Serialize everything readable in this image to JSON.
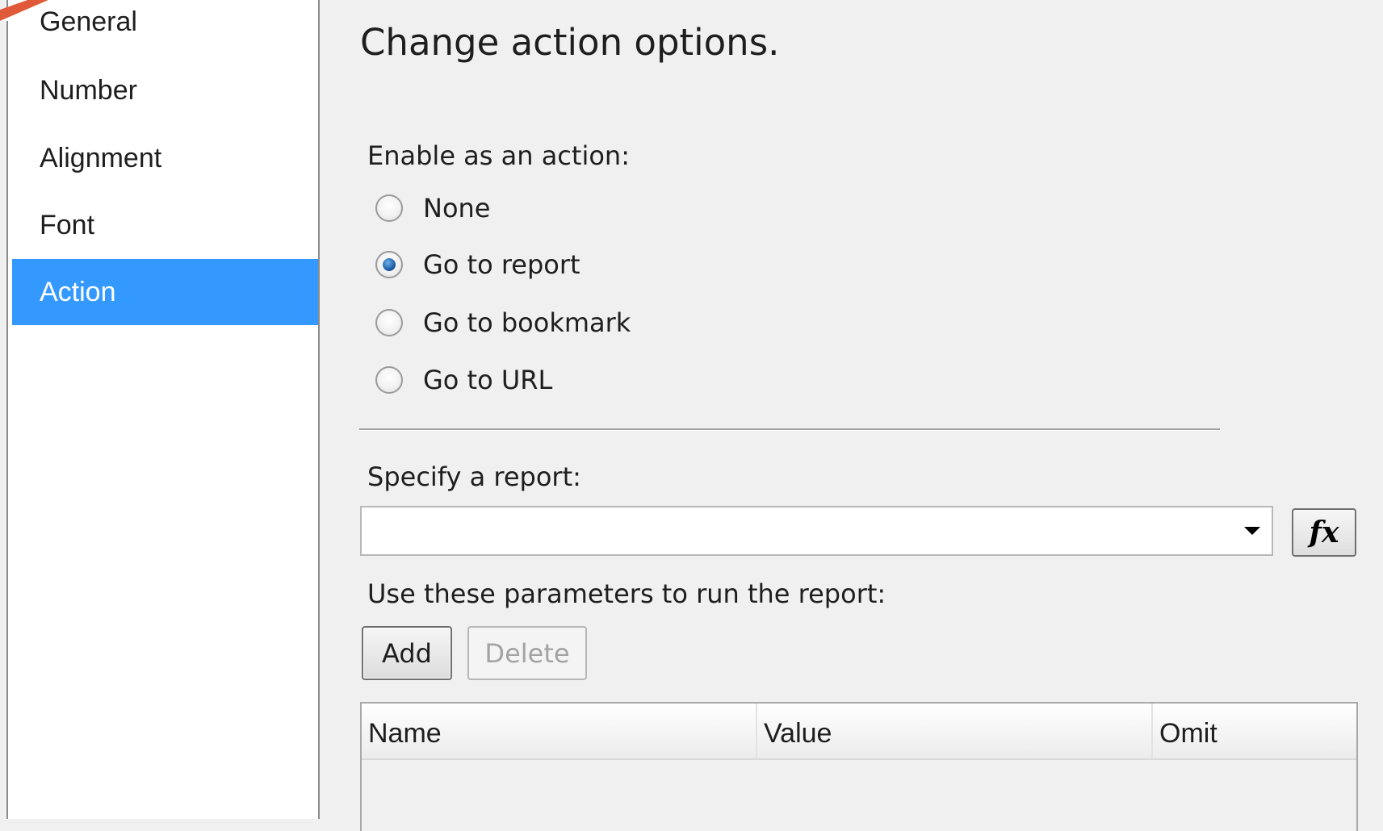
{
  "sidebar": {
    "items": [
      {
        "label": "General",
        "selected": false
      },
      {
        "label": "Number",
        "selected": false
      },
      {
        "label": "Alignment",
        "selected": false
      },
      {
        "label": "Font",
        "selected": false
      },
      {
        "label": "Action",
        "selected": true
      }
    ],
    "selected_color": "#3399ff"
  },
  "page": {
    "title": "Change action options."
  },
  "action": {
    "label": "Enable as an action:",
    "options": [
      {
        "label": "None",
        "checked": false
      },
      {
        "label": "Go to report",
        "checked": true
      },
      {
        "label": "Go to bookmark",
        "checked": false
      },
      {
        "label": "Go to URL",
        "checked": false
      }
    ]
  },
  "report": {
    "label": "Specify a report:",
    "value": "",
    "fx_label": "fx"
  },
  "parameters": {
    "label": "Use these parameters to run the report:",
    "add_label": "Add",
    "delete_label": "Delete",
    "delete_enabled": false,
    "columns": [
      "Name",
      "Value",
      "Omit"
    ],
    "rows": []
  }
}
